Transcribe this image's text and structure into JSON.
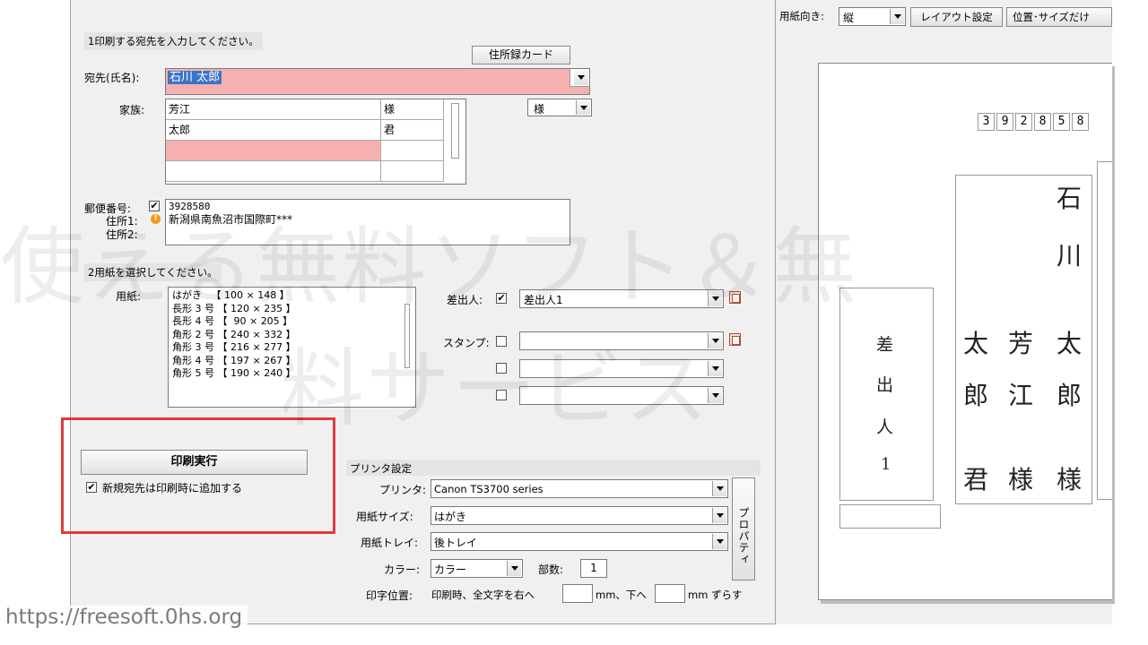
{
  "recipient": {
    "section_header": "1印刷する宛先を入力してください。",
    "address_card_button": "住所録カード",
    "name_label": "宛先(氏名):",
    "name_value": "石川 太郎",
    "family_label": "家族:",
    "family_rows": [
      {
        "name": "芳江",
        "honorific": "様"
      },
      {
        "name": "太郎",
        "honorific": "君"
      },
      {
        "name": "",
        "honorific": ""
      },
      {
        "name": "",
        "honorific": ""
      }
    ],
    "honorific_select": "様",
    "postal_label": "郵便番号:",
    "postal_value": "3928580",
    "address1_label": "住所1:",
    "address1_value": "新潟県南魚沼市国際町***",
    "address2_label": "住所2:",
    "address2_value": ""
  },
  "paper": {
    "section_header": "2用紙を選択してください。",
    "label": "用紙:",
    "items": [
      "はがき   【 100 × 148 】",
      "長形 3 号 【 120 × 235 】",
      "長形 4 号 【  90 × 205 】",
      "角形 2 号 【 240 × 332 】",
      "角形 3 号 【 216 × 277 】",
      "角形 4 号 【 197 × 267 】",
      "角形 5 号 【 190 × 240 】"
    ],
    "sender_label": "差出人:",
    "sender_value": "差出人1",
    "stamp_label": "スタンプ:"
  },
  "print": {
    "execute_button": "印刷実行",
    "add_new_checkbox": "新規宛先は印刷時に追加する"
  },
  "printer_settings": {
    "header": "プリンタ設定",
    "printer_label": "プリンタ:",
    "printer_value": "Canon TS3700 series",
    "paper_size_label": "用紙サイズ:",
    "paper_size_value": "はがき",
    "tray_label": "用紙トレイ:",
    "tray_value": "後トレイ",
    "color_label": "カラー:",
    "color_value": "カラー",
    "copies_label": "部数:",
    "copies_value": "1",
    "position_label": "印字位置:",
    "position_text1": "印刷時、全文字を右へ",
    "position_text2": "mm、下へ",
    "position_text3": "mm ずらす",
    "properties_button": "プロパティ"
  },
  "preview": {
    "orientation_label": "用紙向き:",
    "orientation_value": "縦",
    "layout_button": "レイアウト設定",
    "position_button": "位置･サイズだけ",
    "postal_digits": [
      "3",
      "9",
      "2",
      "8",
      "5",
      "8"
    ],
    "col1_recipient": [
      "石",
      "川",
      "太",
      "郎",
      "様"
    ],
    "col2_family": [
      "芳",
      "江",
      "様"
    ],
    "col3_family": [
      "太",
      "郎",
      "君"
    ],
    "sender_chars": [
      "差",
      "出",
      "人",
      "1"
    ]
  },
  "overlay": {
    "watermark_line1": "使える無料ソフト＆無",
    "watermark_line2": "料サービス",
    "url": "https://freesoft.0hs.org"
  },
  "colors": {
    "name_highlight": "#f7b0b0",
    "selection": "#3a74c9",
    "highlight_rect": "#e03a3a"
  }
}
